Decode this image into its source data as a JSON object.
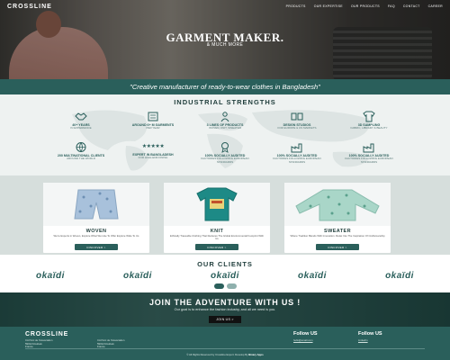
{
  "nav": {
    "logo": "CROSSLINE",
    "items": [
      "PRODUCTS",
      "OUR EXPERTISE",
      "OUR PRODUCTS",
      "FAQ",
      "CONTACT",
      "CAREER"
    ]
  },
  "hero": {
    "title": "GARMENT MAKER.",
    "subtitle": "& MUCH MORE"
  },
  "tagline": "\"Creative manufacturer of ready-to-wear clothes in Bangladesh\"",
  "strengths": {
    "title": "INDUSTRIAL STRENGTHS",
    "row1": [
      {
        "icon": "handshake-icon",
        "title": "40+ YEARS",
        "sub": "IN EXPERIENCE"
      },
      {
        "icon": "garment-icon",
        "title": "AROUND 6+ M GARMENTS",
        "sub": "PER YEAR"
      },
      {
        "icon": "people-icon",
        "title": "3 LINES OF PRODUCTS",
        "sub": "WOVEN, KNIT, SWEATER"
      },
      {
        "icon": "design-icon",
        "title": "DESIGN STUDIOS",
        "sub": "FOR EUROPE & US MARKETS"
      },
      {
        "icon": "tshirt-icon",
        "title": "3D SAMPLING",
        "sub": "FABRIC, LIBRARY & BEAUTY"
      }
    ],
    "row2": [
      {
        "icon": "globe-icon",
        "title": "200 MULTINATIONAL CLIENTS",
        "sub": "AROUND THE WORLD"
      },
      {
        "icon": "stars-icon",
        "title": "EXPERT IN BANGLADESH",
        "sub": "FOR HIGH-END FINISH",
        "stars": "★★★★★"
      },
      {
        "icon": "badge-icon",
        "title": "100% SOCIALLY AUDITED",
        "sub": "FACTORIES FOLLOWING EUROPEAN STANDARDS"
      },
      {
        "icon": "factory-icon",
        "title": "100% SOCIALLY AUDITED",
        "sub": "FACTORIES FOLLOWING EUROPEAN STANDARDS"
      },
      {
        "icon": "factory-icon",
        "title": "100% SOCIALLY AUDITED",
        "sub": "FACTORIES FOLLOWING EUROPEAN STANDARDS"
      }
    ]
  },
  "products": [
    {
      "name": "WOVEN",
      "desc": "We're Experts in Woven, Explore What We Like To Offer Explore Wide To Us",
      "button": "DISCOVER >"
    },
    {
      "name": "KNIT",
      "desc": "Ethically Traceable Clothing That Reduces The Global Environmental Footprint With Us",
      "button": "DISCOVER >"
    },
    {
      "name": "SWEATER",
      "desc": "Where Tradition Blends With Innovation. Relax Into The Inspiration Of Craftsmanship",
      "button": "DISCOVER >"
    }
  ],
  "clients": {
    "title": "OUR CLIENTS",
    "logos": [
      "okaïdi",
      "okaïdi",
      "okaïdi",
      "okaïdi",
      "okaïdi"
    ]
  },
  "join": {
    "title": "JOIN THE ADVENTURE WITH US !",
    "subtitle": "Our goal is to enhance the fashion industry, and all we need is you.",
    "button": "JOIN US >"
  },
  "footer": {
    "brand": "CROSSLINE",
    "col1": [
      "CA Parc de l'Association",
      "59012 Roubaix",
      "France"
    ],
    "col2": [
      "CA Parc de l'Association",
      "59012 Roubaix",
      "France"
    ],
    "follow1": "Follow US",
    "follow1_link": "hello@email.com",
    "follow2": "Follow US",
    "follow2_link": "LinkedIn",
    "copyright": "© All Rights Reserved by Crossline Export. Develop By",
    "copyright_author": "Binary Apps"
  },
  "colors": {
    "primary": "#2a5f5b",
    "light_band": "#eef2f1",
    "products_band": "#d6dedc"
  }
}
